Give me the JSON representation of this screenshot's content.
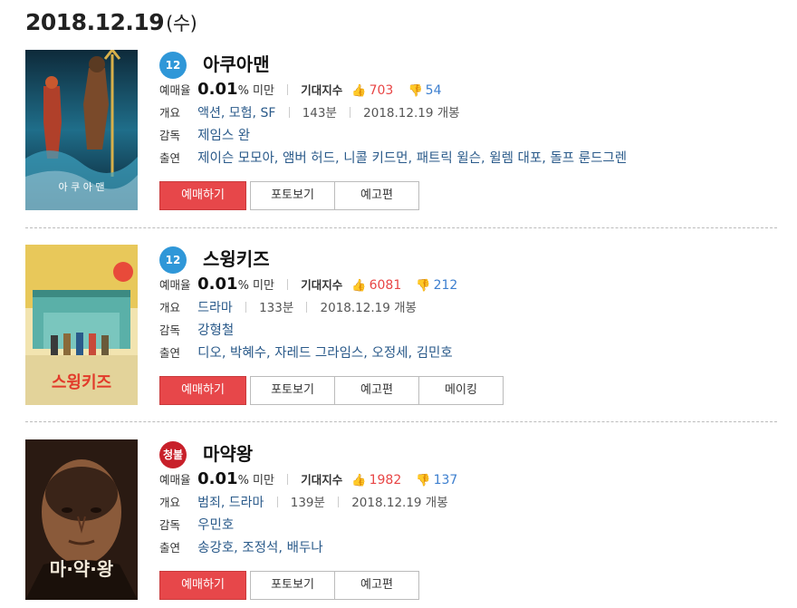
{
  "date": {
    "text": "2018.12.19",
    "day": "(수)"
  },
  "labels": {
    "rate": "예매율",
    "rate_suffix": "% 미만",
    "expect": "기대지수",
    "summary": "개요",
    "director": "감독",
    "cast": "출연"
  },
  "movies": [
    {
      "rating": "12",
      "title": "아쿠아맨",
      "rate": "0.01",
      "likes": "703",
      "dislikes": "54",
      "genre": "액션, 모험, SF",
      "runtime": "143분",
      "release": "2018.12.19 개봉",
      "director": "제임스 완",
      "cast": "제이슨 모모아, 앰버 허드, 니콜 키드먼, 패트릭 윌슨, 윌렘 대포, 돌프 룬드그렌",
      "buttons": [
        "예매하기",
        "포토보기",
        "예고편"
      ],
      "poster_text": "아 쿠 아 맨"
    },
    {
      "rating": "12",
      "title": "스윙키즈",
      "rate": "0.01",
      "likes": "6081",
      "dislikes": "212",
      "genre": "드라마",
      "runtime": "133분",
      "release": "2018.12.19 개봉",
      "director": "강형철",
      "cast": "디오, 박혜수, 자레드 그라임스, 오정세, 김민호",
      "buttons": [
        "예매하기",
        "포토보기",
        "예고편",
        "메이킹"
      ],
      "poster_text": "스윙키즈"
    },
    {
      "rating": "청불",
      "title": "마약왕",
      "rate": "0.01",
      "likes": "1982",
      "dislikes": "137",
      "genre": "범죄, 드라마",
      "runtime": "139분",
      "release": "2018.12.19 개봉",
      "director": "우민호",
      "cast": "송강호, 조정석, 배두나",
      "buttons": [
        "예매하기",
        "포토보기",
        "예고편"
      ],
      "poster_text": "마·약·왕"
    }
  ],
  "colors": {
    "book_button": "#e7474a",
    "like": "#e84545",
    "dislike": "#3d7fcf",
    "badge_12": "#2f97d8",
    "badge_adult": "#c8202a"
  },
  "icons": {
    "like": "thumbs-up-icon",
    "dislike": "thumbs-down-icon"
  }
}
